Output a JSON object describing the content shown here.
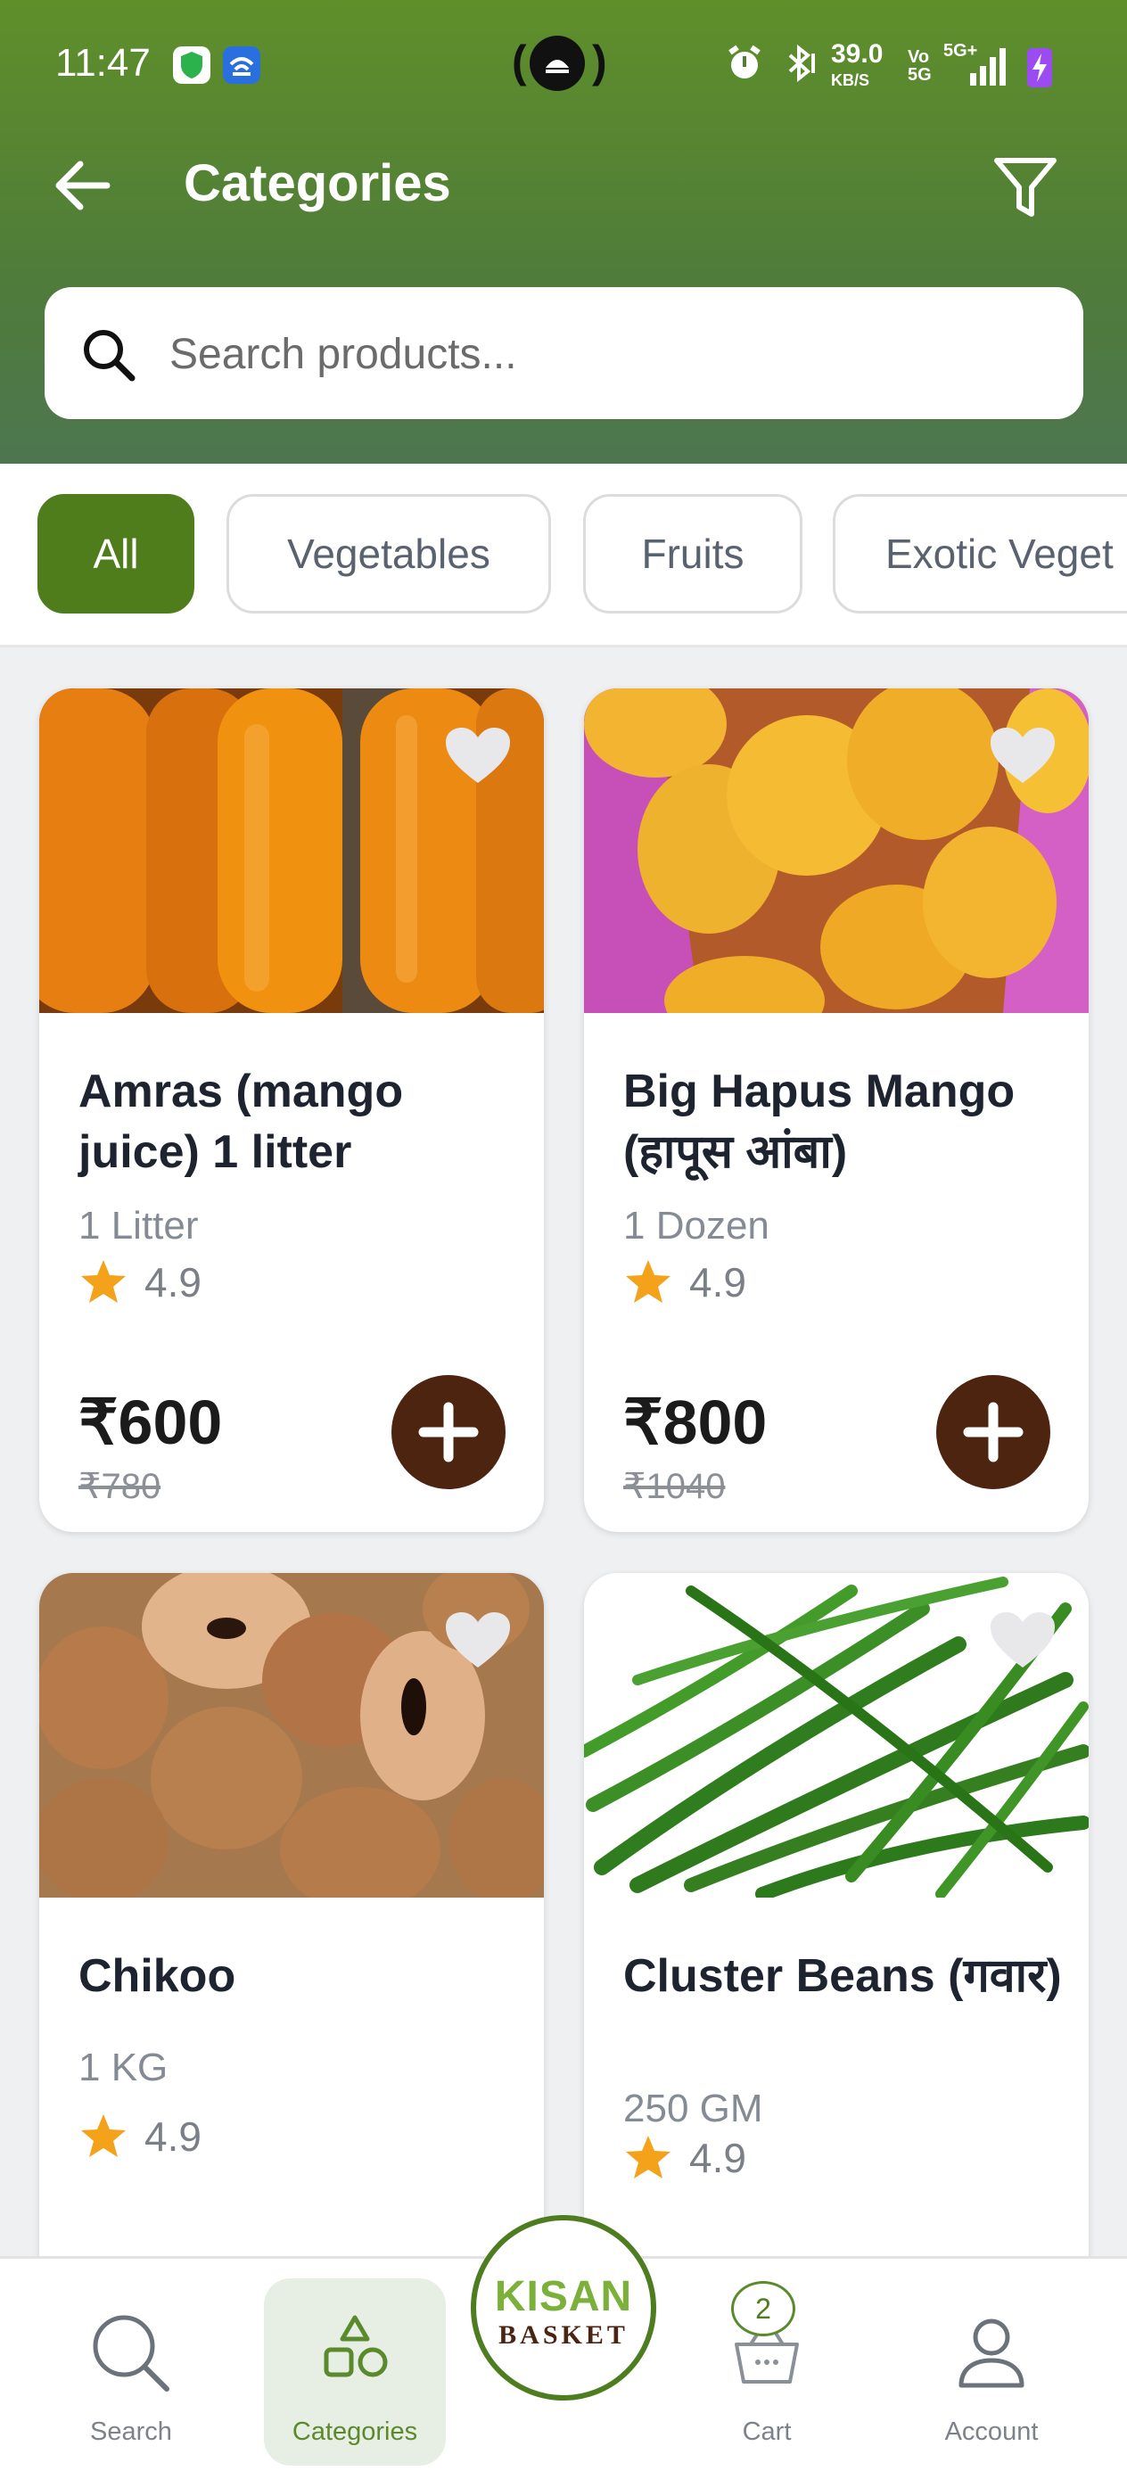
{
  "status_bar": {
    "time": "11:47",
    "net_speed": "39.0",
    "net_unit": "KB/S",
    "volte": "Vo 5G",
    "network": "5G+",
    "icons": [
      "vpn-shield-icon",
      "wifi-app-icon",
      "hotspot-icon",
      "alarm-icon",
      "bluetooth-icon",
      "signal-icon",
      "battery-charging-icon"
    ]
  },
  "header": {
    "title": "Categories",
    "back_icon": "arrow-left-icon",
    "filter_icon": "funnel-filter-icon"
  },
  "search": {
    "placeholder": "Search products..."
  },
  "categories": [
    {
      "label": "All",
      "active": true
    },
    {
      "label": "Vegetables",
      "active": false
    },
    {
      "label": "Fruits",
      "active": false
    },
    {
      "label": "Exotic Veget",
      "active": false
    }
  ],
  "products": [
    {
      "name": "Amras (mango juice) 1 litter",
      "unit": "1 Litter",
      "rating": "4.9",
      "price": "₹600",
      "original_price": "₹780",
      "image": "mango juice bottles"
    },
    {
      "name": "Big Hapus Mango (हापूस आंबा)",
      "unit": "1 Dozen",
      "rating": "4.9",
      "price": "₹800",
      "original_price": "₹1040",
      "image": "mangoes in box"
    },
    {
      "name": "Chikoo",
      "unit": "1 KG",
      "rating": "4.9",
      "image": "chikoo fruits in basket"
    },
    {
      "name": "Cluster Beans (गवार)",
      "unit": "250 GM",
      "rating": "4.9",
      "image": "green cluster beans"
    }
  ],
  "bottom_nav": {
    "items": [
      {
        "label": "Search",
        "icon": "search-icon"
      },
      {
        "label": "Categories",
        "icon": "shapes-icon",
        "active": true
      },
      {
        "label": "Cart",
        "icon": "basket-icon"
      },
      {
        "label": "Account",
        "icon": "user-icon"
      }
    ],
    "cart_count": "2",
    "logo": {
      "top": "KISAN",
      "bottom": "BASKET"
    }
  },
  "colors": {
    "header_green": "#5a8a2e",
    "active_chip": "#4f7d1b",
    "add_button": "#4d2410",
    "star": "#f4a21a"
  }
}
